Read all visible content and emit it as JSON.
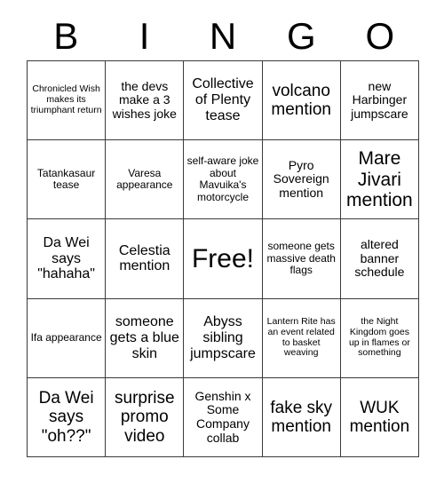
{
  "card": {
    "title": "BINGO",
    "header_letters": [
      "B",
      "I",
      "N",
      "G",
      "O"
    ],
    "rows": [
      [
        {
          "text": "Chronicled Wish makes its triumphant return",
          "size": "xs"
        },
        {
          "text": "the devs make a 3 wishes joke",
          "size": "m"
        },
        {
          "text": "Collective of Plenty tease",
          "size": "l"
        },
        {
          "text": "volcano mention",
          "size": "xl"
        },
        {
          "text": "new Harbinger jumpscare",
          "size": "m"
        }
      ],
      [
        {
          "text": "Tatankasaur tease",
          "size": "s"
        },
        {
          "text": "Varesa appearance",
          "size": "s"
        },
        {
          "text": "self-aware joke about Mavuika's motorcycle",
          "size": "s"
        },
        {
          "text": "Pyro Sovereign mention",
          "size": "m"
        },
        {
          "text": "Mare Jivari mention",
          "size": "xxl"
        }
      ],
      [
        {
          "text": "Da Wei says \"hahaha\"",
          "size": "l"
        },
        {
          "text": "Celestia mention",
          "size": "l"
        },
        {
          "text": "Free!",
          "size": "free"
        },
        {
          "text": "someone gets massive death flags",
          "size": "s"
        },
        {
          "text": "altered banner schedule",
          "size": "m"
        }
      ],
      [
        {
          "text": "Ifa appearance",
          "size": "s"
        },
        {
          "text": "someone gets a blue skin",
          "size": "l"
        },
        {
          "text": "Abyss sibling jumpscare",
          "size": "l"
        },
        {
          "text": "Lantern Rite has an event related to basket weaving",
          "size": "xs"
        },
        {
          "text": "the Night Kingdom goes up in flames or something",
          "size": "xs"
        }
      ],
      [
        {
          "text": "Da Wei says \"oh??\"",
          "size": "xl"
        },
        {
          "text": "surprise promo video",
          "size": "xl"
        },
        {
          "text": "Genshin x Some Company collab",
          "size": "m"
        },
        {
          "text": "fake sky mention",
          "size": "xl"
        },
        {
          "text": "WUK mention",
          "size": "xl"
        }
      ]
    ],
    "colors": {
      "background": "#ffffff",
      "border": "#3a3a3a",
      "text": "#000000"
    }
  }
}
